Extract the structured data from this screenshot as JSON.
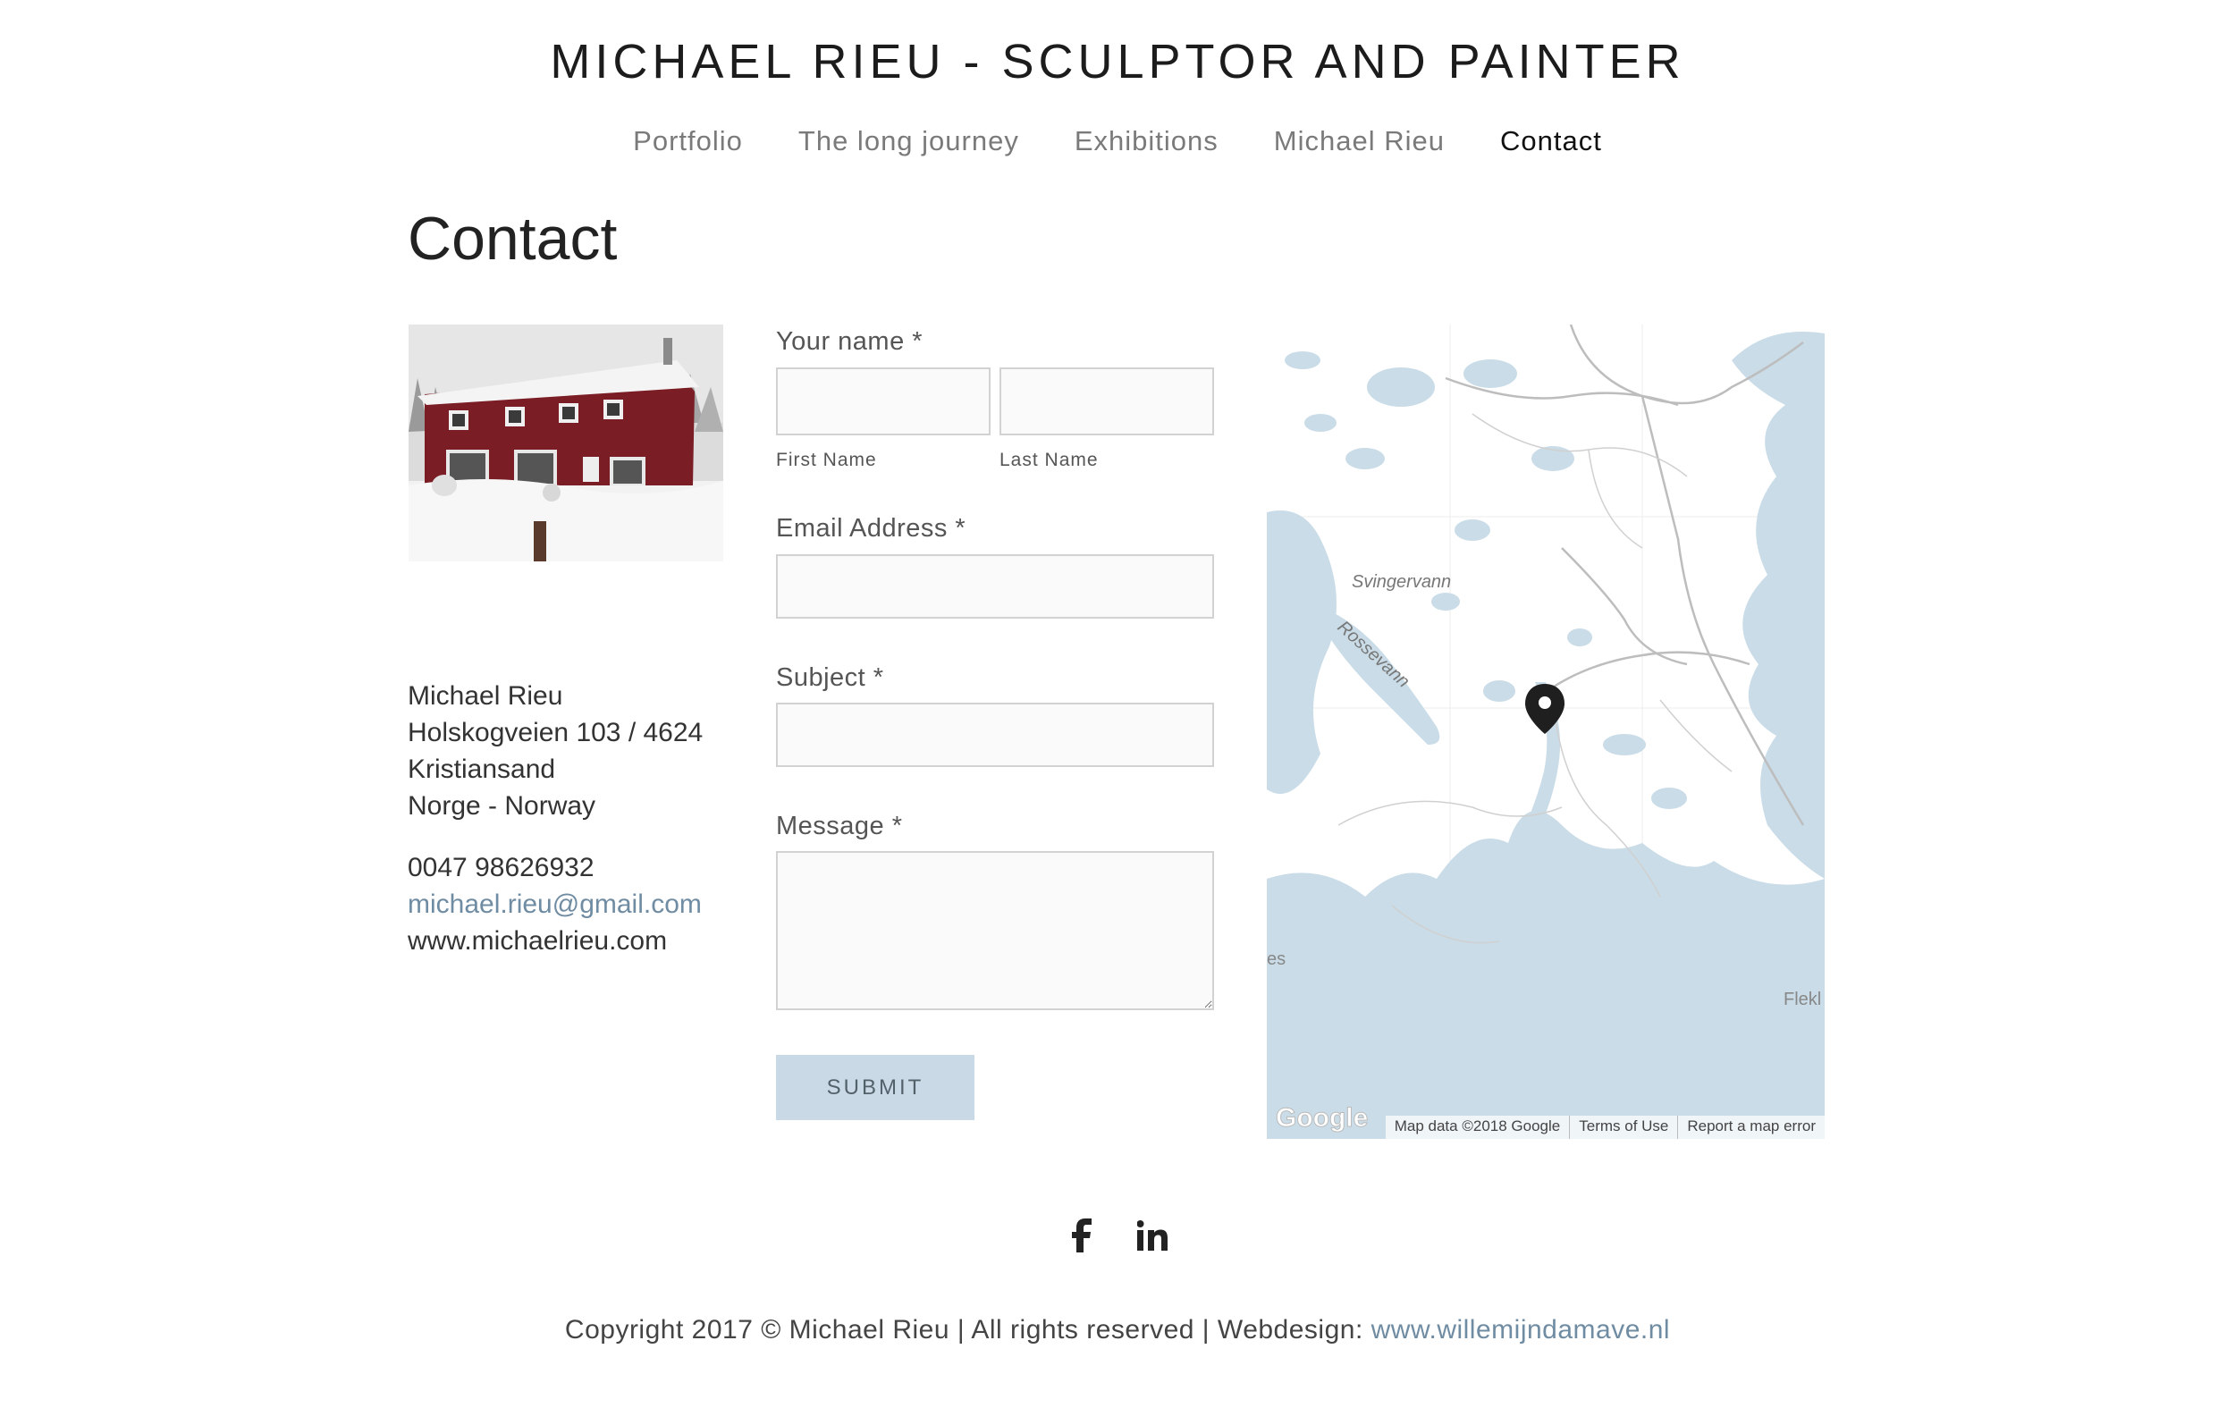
{
  "header": {
    "site_title": "MICHAEL RIEU - SCULPTOR AND PAINTER",
    "nav": [
      {
        "label": "Portfolio"
      },
      {
        "label": "The long journey"
      },
      {
        "label": "Exhibitions"
      },
      {
        "label": "Michael Rieu"
      },
      {
        "label": "Contact",
        "active": true
      }
    ]
  },
  "page": {
    "title": "Contact"
  },
  "contact_info": {
    "name": "Michael Rieu",
    "street": "Holskogveien 103 / 4624",
    "city": "Kristiansand",
    "country": "Norge - Norway",
    "phone": "0047 98626932",
    "email": "michael.rieu@gmail.com",
    "website": "www.michaelrieu.com"
  },
  "form": {
    "name_label": "Your name *",
    "first_name_label": "First Name",
    "last_name_label": "Last Name",
    "first_name_value": "",
    "last_name_value": "",
    "email_label": "Email Address *",
    "email_value": "",
    "subject_label": "Subject *",
    "subject_value": "",
    "message_label": "Message *",
    "message_value": "",
    "submit_label": "SUBMIT"
  },
  "map": {
    "labels": {
      "lake1": "Svingervann",
      "lake2": "Rossevann",
      "edge_left": "es",
      "edge_right": "Flekl",
      "google": "Google"
    },
    "attribution": {
      "data": "Map data ©2018 Google",
      "terms": "Terms of Use",
      "report": "Report a map error"
    },
    "water_color": "#c9dce7",
    "road_color": "#bdbdbd"
  },
  "social": {
    "icons": [
      "facebook-icon",
      "linkedin-icon"
    ]
  },
  "footer": {
    "copyright": "Copyright 2017 © Michael Rieu | All rights reserved | Webdesign: ",
    "designer_link": "www.willemijndamave.nl"
  }
}
